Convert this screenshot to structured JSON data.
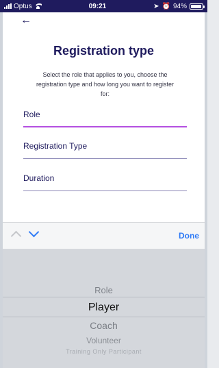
{
  "status_bar": {
    "carrier": "Optus",
    "time": "09:21",
    "battery_percent": "94%",
    "battery_level": 0.94
  },
  "header": {
    "back_icon": "back-arrow-icon",
    "back_glyph": "←",
    "title": "Registration type"
  },
  "instructions": "Select the role that applies to you, choose the registration type and how long you want to register for:",
  "fields": {
    "role": "Role",
    "registration_type": "Registration Type",
    "duration": "Duration"
  },
  "toolbar": {
    "done_label": "Done"
  },
  "picker": {
    "options": [
      "Role",
      "Player",
      "Coach",
      "Volunteer",
      "Training Only Participant"
    ],
    "selected": "Player"
  },
  "colors": {
    "brand": "#1f1b5e",
    "active_underline": "#b44fe0",
    "ios_blue": "#2f7bf6"
  }
}
